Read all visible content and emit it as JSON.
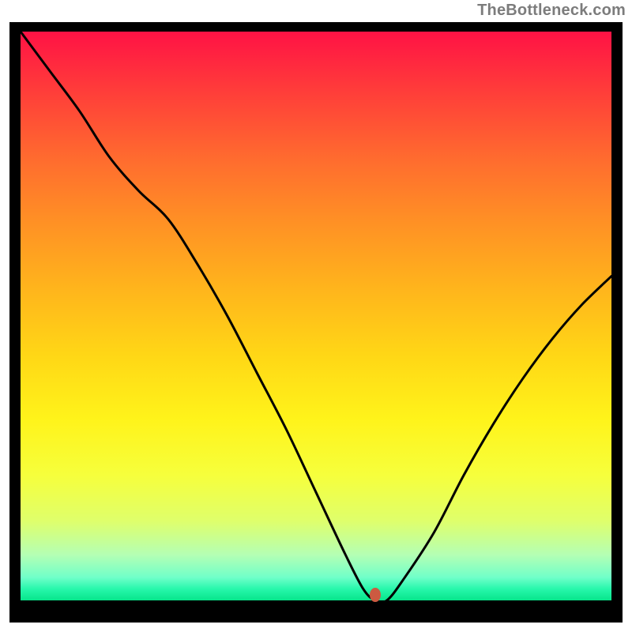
{
  "attribution": "TheBottleneck.com",
  "colors": {
    "frame": "#000000",
    "curve": "#000000",
    "dot": "#cc5a41"
  },
  "chart_data": {
    "type": "line",
    "title": "",
    "xlabel": "",
    "ylabel": "",
    "xlim": [
      0,
      100
    ],
    "ylim": [
      0,
      100
    ],
    "annotations": [
      {
        "name": "optimal-point-marker",
        "x": 60,
        "y": 1
      }
    ],
    "series": [
      {
        "name": "bottleneck-curve",
        "x": [
          0,
          5,
          10,
          15,
          20,
          25,
          30,
          35,
          40,
          45,
          50,
          55,
          58,
          60,
          62,
          65,
          70,
          75,
          80,
          85,
          90,
          95,
          100
        ],
        "y": [
          100,
          93,
          86,
          78,
          72,
          67,
          59,
          50,
          40,
          30,
          19,
          8,
          2,
          0,
          0,
          4,
          12,
          22,
          31,
          39,
          46,
          52,
          57
        ]
      }
    ],
    "background_gradient": {
      "type": "vertical",
      "stops": [
        {
          "pos": 0.0,
          "color": "#ff1245"
        },
        {
          "pos": 0.1,
          "color": "#ff3b3a"
        },
        {
          "pos": 0.22,
          "color": "#ff6a2f"
        },
        {
          "pos": 0.33,
          "color": "#ff8f25"
        },
        {
          "pos": 0.45,
          "color": "#ffb41c"
        },
        {
          "pos": 0.57,
          "color": "#ffd716"
        },
        {
          "pos": 0.68,
          "color": "#fff31a"
        },
        {
          "pos": 0.78,
          "color": "#f6ff3c"
        },
        {
          "pos": 0.86,
          "color": "#dfff6b"
        },
        {
          "pos": 0.92,
          "color": "#b4ffb4"
        },
        {
          "pos": 0.96,
          "color": "#6fffc9"
        },
        {
          "pos": 0.98,
          "color": "#27f7ab"
        },
        {
          "pos": 1.0,
          "color": "#07e58b"
        }
      ]
    }
  }
}
